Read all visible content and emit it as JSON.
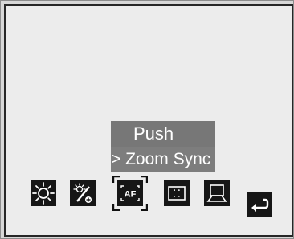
{
  "menu": {
    "items": [
      {
        "label": "Push"
      },
      {
        "label": "> Zoom Sync"
      }
    ]
  },
  "toolbar": {
    "buttons": [
      {
        "icon": "brightness-icon"
      },
      {
        "icon": "light-adjust-icon"
      },
      {
        "icon": "af-icon",
        "text": "AF"
      },
      {
        "icon": "frame-icon"
      },
      {
        "icon": "scene-icon"
      },
      {
        "icon": "back-icon"
      }
    ]
  }
}
